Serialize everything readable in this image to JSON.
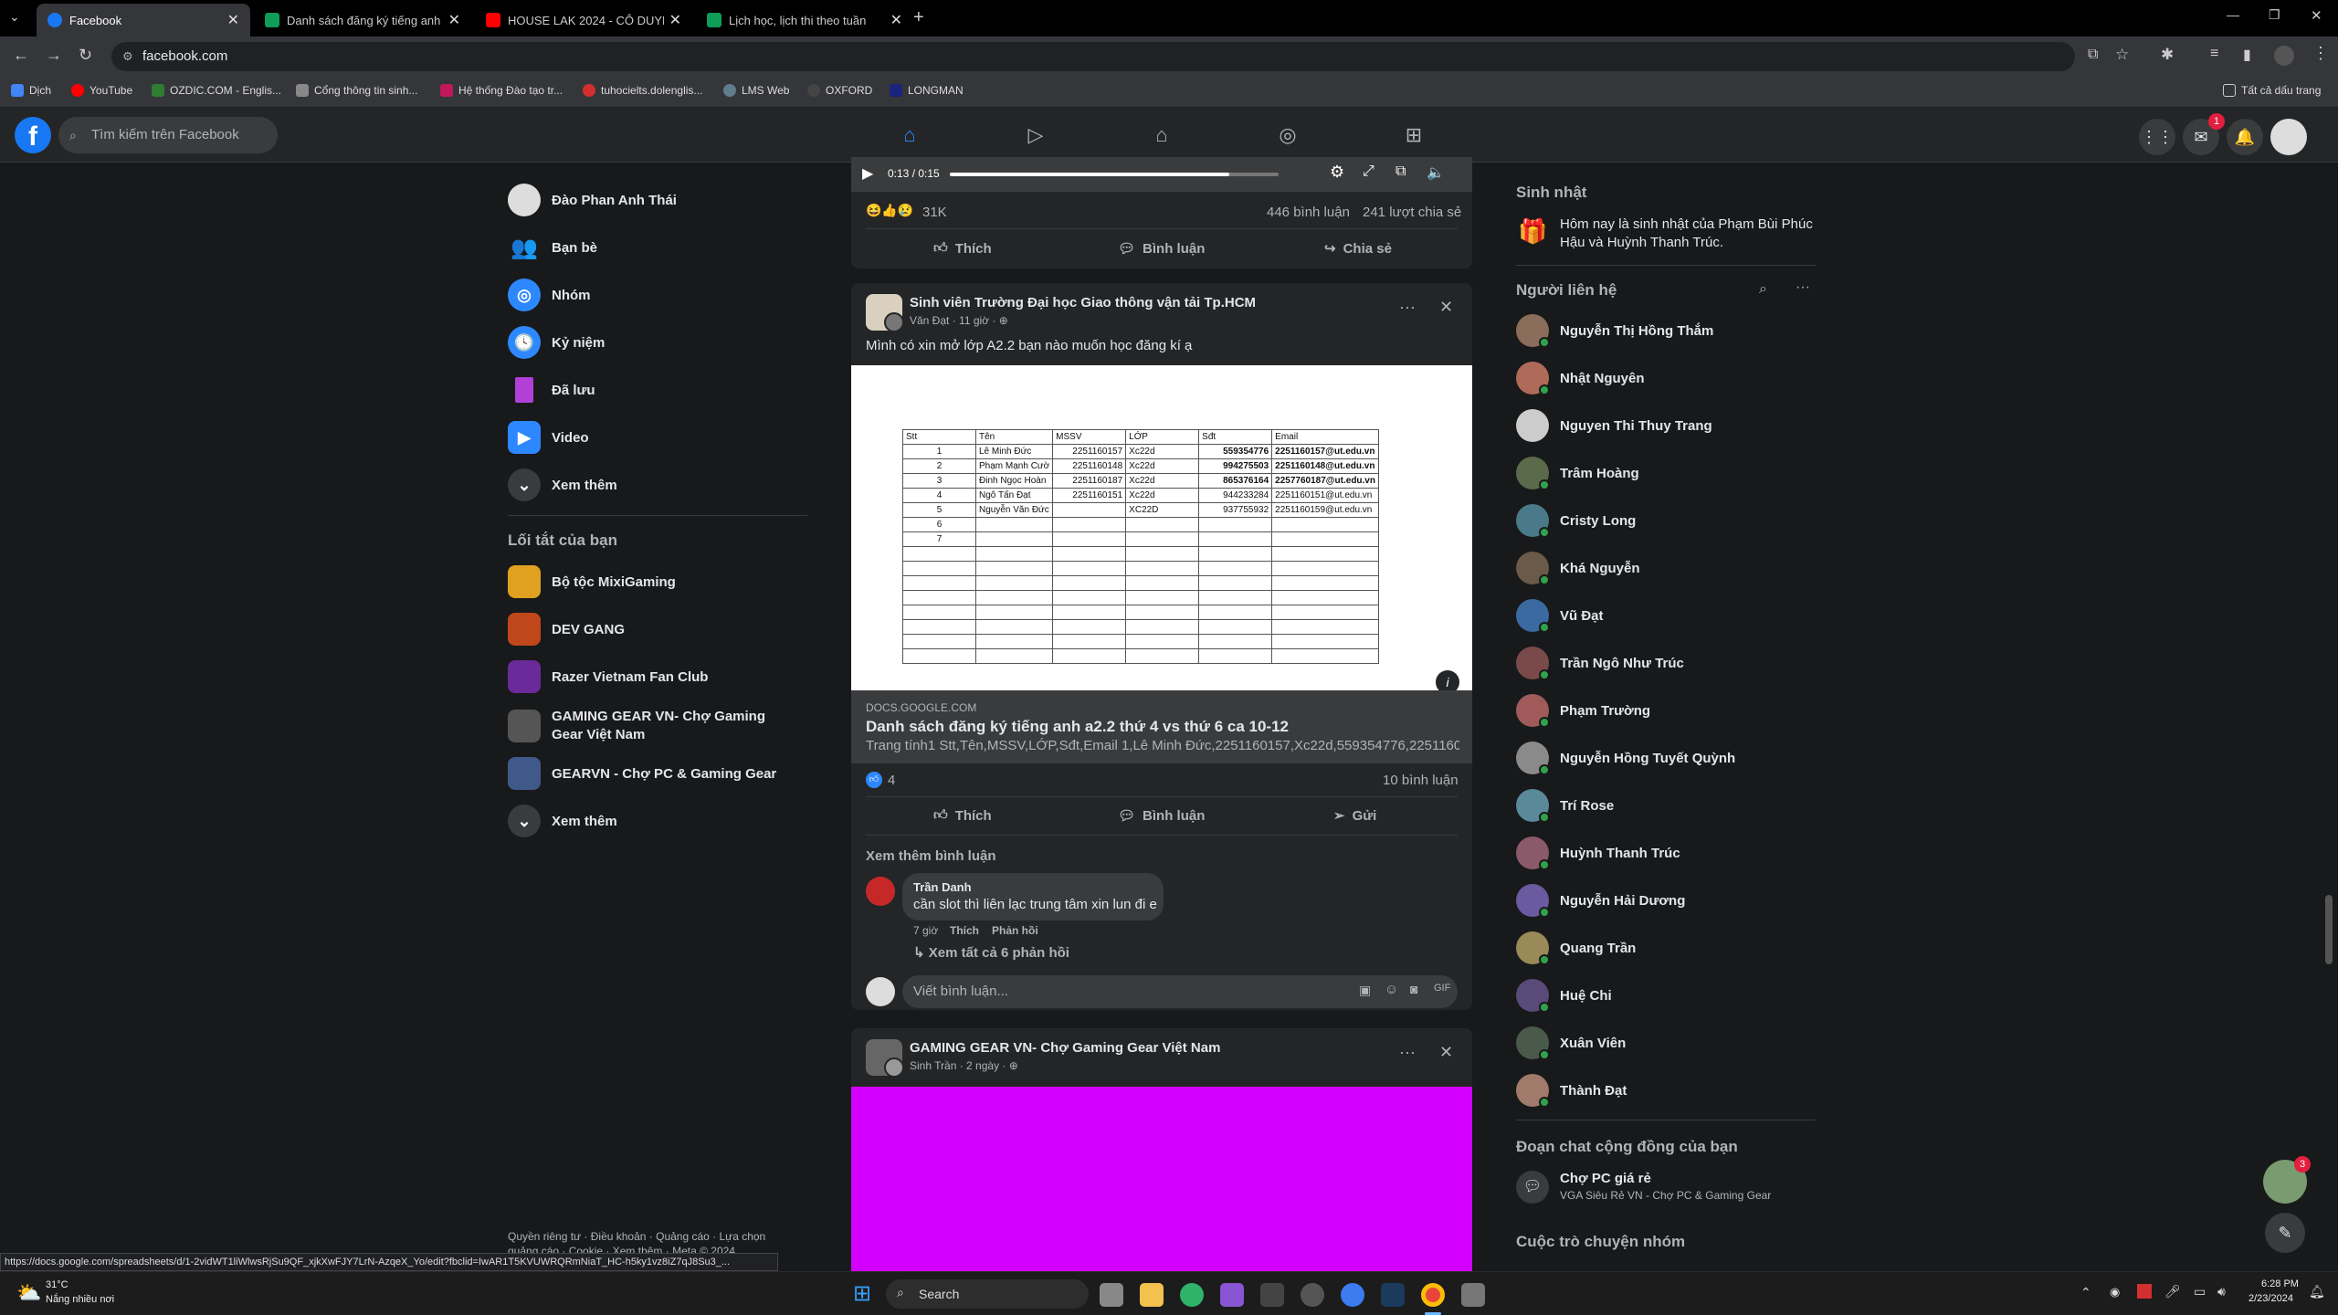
{
  "browser": {
    "tabs": [
      {
        "title": "Facebook",
        "active": true,
        "color": "#1877f2"
      },
      {
        "title": "Danh sách đăng ký tiếng anh a...",
        "active": false,
        "color": "#0f9d58"
      },
      {
        "title": "HOUSE LAK 2024 - CÔ DUYÊN...",
        "active": false,
        "color": "#ff0000"
      },
      {
        "title": "Lịch học, lịch thi theo tuần",
        "active": false,
        "color": "#0f9d58"
      }
    ],
    "url": "facebook.com",
    "bookmarks": [
      "Dịch",
      "YouTube",
      "OZDIC.COM - Englis...",
      "Cổng thông tin sinh...",
      "Hệ thống Đào tạo tr...",
      "tuhocielts.dolenglis...",
      "LMS Web",
      "OXFORD",
      "LONGMAN"
    ],
    "all_bookmarks": "Tất cả dấu trang"
  },
  "header": {
    "logo": "f",
    "search_placeholder": "Tìm kiếm trên Facebook",
    "messenger_badge": "1"
  },
  "left": {
    "items": [
      {
        "label": "Đào Phan Anh Thái",
        "icon": "avatar"
      },
      {
        "label": "Bạn bè",
        "icon": "friends-icon"
      },
      {
        "label": "Nhóm",
        "icon": "groups-icon"
      },
      {
        "label": "Kỷ niệm",
        "icon": "memories-icon"
      },
      {
        "label": "Đã lưu",
        "icon": "saved-icon"
      },
      {
        "label": "Video",
        "icon": "video-icon"
      },
      {
        "label": "Xem thêm",
        "icon": "chevron-down-icon"
      }
    ],
    "shortcuts_title": "Lối tắt của bạn",
    "shortcuts": [
      {
        "label": "Bộ tộc MixiGaming"
      },
      {
        "label": "DEV GANG"
      },
      {
        "label": "Razer Vietnam Fan Club"
      },
      {
        "label": "GAMING GEAR VN- Chợ Gaming Gear Việt Nam"
      },
      {
        "label": "GEARVN - Chợ PC & Gaming Gear"
      }
    ],
    "more": "Xem thêm",
    "footer": "Quyền riêng tư · Điều khoản · Quảng cáo · Lựa chọn quảng cáo · Cookie · Xem thêm · Meta © 2024"
  },
  "post0": {
    "video_time": "0:13 / 0:15",
    "progress": 0.85,
    "reactions": "31K",
    "comments": "446 bình luận",
    "shares": "241 lượt chia sẻ",
    "like": "Thích",
    "comment": "Bình luận",
    "share": "Chia sẻ"
  },
  "post1": {
    "group": "Sinh viên Trường Đại học Giao thông vận tải Tp.HCM",
    "author": "Văn Đạt",
    "time": "11 giờ",
    "text": "Mình có xin mở lớp A2.2 bạn nào muốn học đăng kí ạ",
    "sheet": {
      "headers": [
        "Stt",
        "Tên",
        "MSSV",
        "LỚP",
        "Sđt",
        "Email"
      ],
      "rows": [
        [
          "1",
          "Lê Minh Đức",
          "2251160157",
          "Xc22d",
          "559354776",
          "2251160157@ut.edu.vn"
        ],
        [
          "2",
          "Phạm Mạnh Cườ",
          "2251160148",
          "Xc22d",
          "994275503",
          "2251160148@ut.edu.vn"
        ],
        [
          "3",
          "Đinh Ngọc Hoàn",
          "2251160187",
          "Xc22d",
          "865376164",
          "2257760187@ut.edu.vn"
        ],
        [
          "4",
          "Ngô Tấn Đạt",
          "2251160151",
          "Xc22d",
          "944233284",
          "2251160151@ut.edu.vn"
        ],
        [
          "5",
          "Nguyễn Văn Đức",
          "",
          "XC22D",
          "937755932",
          "2251160159@ut.edu.vn"
        ],
        [
          "6",
          "",
          "",
          "",
          "",
          ""
        ],
        [
          "7",
          "",
          "",
          "",
          "",
          ""
        ]
      ]
    },
    "link_domain": "DOCS.GOOGLE.COM",
    "link_title": "Danh sách đăng ký tiếng anh a2.2 thứ 4 vs thứ 6 ca 10-12",
    "link_desc": "Trang tính1 Stt,Tên,MSSV,LỚP,Sđt,Email 1,Lê Minh Đức,2251160157,Xc22d,559354776,2251160...",
    "likes": "4",
    "comments": "10 bình luận",
    "like": "Thích",
    "comment": "Bình luận",
    "send": "Gửi",
    "more_comments": "Xem thêm bình luận",
    "c_author": "Trần Danh",
    "c_text": "cần slot thì liên lạc trung tâm xin lun đi e",
    "c_time": "7 giờ",
    "c_like": "Thích",
    "c_reply": "Phản hồi",
    "c_replies": "Xem tất cả 6 phản hồi",
    "write": "Viết bình luận..."
  },
  "post2": {
    "group": "GAMING GEAR VN- Chợ Gaming Gear Việt Nam",
    "author": "Sinh Trần",
    "time": "2 ngày",
    "image_color": "#d400ff"
  },
  "right": {
    "birthday_title": "Sinh nhật",
    "birthday_text": "Hôm nay là sinh nhật của Phạm Bùi Phúc Hậu và Huỳnh Thanh Trúc.",
    "contacts_title": "Người liên hệ",
    "contacts": [
      "Nguyễn Thị Hồng Thắm",
      "Nhật Nguyên",
      "Nguyen Thi Thuy Trang",
      "Trâm Hoàng",
      "Cristy Long",
      "Khá Nguyễn",
      "Vũ Đạt",
      "Trần Ngô Như Trúc",
      "Phạm Trường",
      "Nguyễn Hồng Tuyết Quỳnh",
      "Trí Rose",
      "Huỳnh Thanh Trúc",
      "Nguyễn Hải Dương",
      "Quang Trần",
      "Huệ Chi",
      "Xuân Viên",
      "Thành Đạt"
    ],
    "community_title": "Đoạn chat cộng đồng của bạn",
    "community_name": "Chợ PC giá rẻ",
    "community_sub": "VGA Siêu Rẻ VN - Chợ PC & Gaming Gear",
    "group_chat_title": "Cuộc trò chuyện nhóm",
    "chat_badge": "3"
  },
  "status_url": "https://docs.google.com/spreadsheets/d/1-2vidWT1liWlwsRjSu9QF_xjkXwFJY7LrN-AzqeX_Yo/edit?fbclid=IwAR1T5KVUWRQRmNiaT_HC-h5ky1vz8iZ7qJ8Su3_...",
  "taskbar": {
    "temp": "31°C",
    "weather": "Nắng nhiều nơi",
    "search": "Search",
    "time": "6:28 PM",
    "date": "2/23/2024"
  }
}
